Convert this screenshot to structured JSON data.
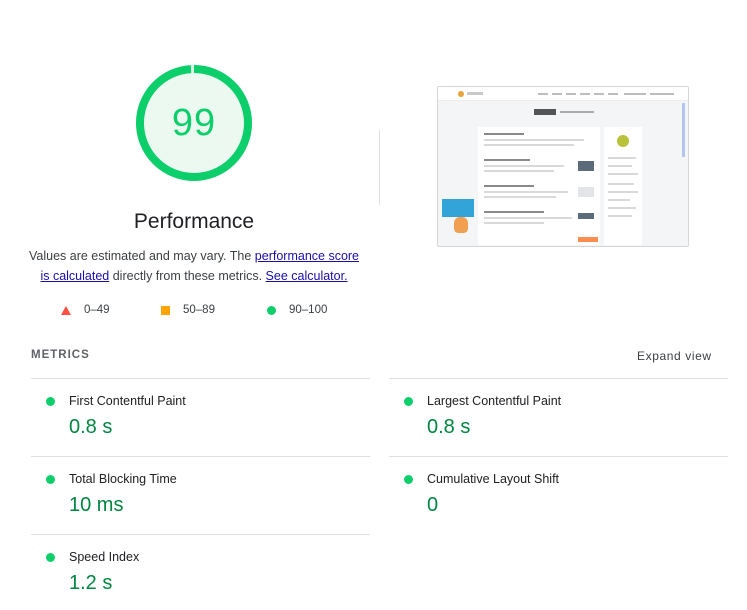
{
  "score": {
    "value": "99",
    "label": "Performance",
    "ring_color": "#0cce6b",
    "fill_fraction": 0.99
  },
  "description": {
    "text_before": "Values are estimated and may vary. The ",
    "link_score": "performance score is calculated",
    "text_middle": " directly from these metrics. ",
    "link_calculator": "See calculator."
  },
  "legend": [
    {
      "icon": "red-triangle-icon",
      "range": "0–49",
      "color": "#ff4e42"
    },
    {
      "icon": "orange-square-icon",
      "range": "50–89",
      "color": "#ffa400"
    },
    {
      "icon": "green-circle-icon",
      "range": "90–100",
      "color": "#0cce6b"
    }
  ],
  "metrics_section": {
    "title": "METRICS",
    "expand_label": "Expand view"
  },
  "metrics": [
    {
      "name": "First Contentful Paint",
      "value": "0.8 s"
    },
    {
      "name": "Largest Contentful Paint",
      "value": "0.8 s"
    },
    {
      "name": "Total Blocking Time",
      "value": "10 ms"
    },
    {
      "name": "Cumulative Layout Shift",
      "value": "0"
    },
    {
      "name": "Speed Index",
      "value": "1.2 s"
    }
  ]
}
